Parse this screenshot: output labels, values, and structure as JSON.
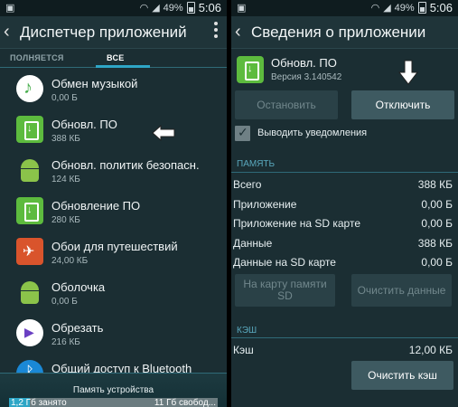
{
  "status_bar": {
    "battery_percent": "49%",
    "time": "5:06"
  },
  "left": {
    "title": "Диспетчер приложений",
    "tabs": [
      "ПОЛНЯЕТСЯ",
      "ВСЕ"
    ],
    "apps": [
      {
        "name": "Обмен музыкой",
        "size": "0,00 Б",
        "icon": "music-share-icon"
      },
      {
        "name": "Обновл. ПО",
        "size": "388 КБ",
        "icon": "software-update-icon"
      },
      {
        "name": "Обновл. политик безопасн.",
        "size": "124 КБ",
        "icon": "android-icon"
      },
      {
        "name": "Обновление ПО",
        "size": "280 КБ",
        "icon": "software-update-icon"
      },
      {
        "name": "Обои для путешествий",
        "size": "24,00 КБ",
        "icon": "travel-wallpaper-icon"
      },
      {
        "name": "Оболочка",
        "size": "0,00 Б",
        "icon": "android-icon"
      },
      {
        "name": "Обрезать",
        "size": "216 КБ",
        "icon": "trim-play-icon"
      },
      {
        "name": "Общий доступ к Bluetooth",
        "size": "",
        "icon": "bluetooth-icon"
      }
    ],
    "storage": {
      "title": "Память устройства",
      "used": "1,2 Гб занято",
      "free": "11 Гб свобод...",
      "used_fraction": 0.1
    }
  },
  "right": {
    "title": "Сведения о приложении",
    "app": {
      "name": "Обновл. ПО",
      "version": "Версия 3.140542"
    },
    "buttons": {
      "stop": "Остановить",
      "disable": "Отключить",
      "move_to_sd": "На карту памяти SD",
      "clear_data": "Очистить данные",
      "clear_cache": "Очистить кэш"
    },
    "notifications_label": "Выводить уведомления",
    "memory_header": "ПАМЯТЬ",
    "memory": [
      {
        "label": "Всего",
        "value": "388 КБ"
      },
      {
        "label": "Приложение",
        "value": "0,00 Б"
      },
      {
        "label": "Приложение на SD карте",
        "value": "0,00 Б"
      },
      {
        "label": "Данные",
        "value": "388 КБ"
      },
      {
        "label": "Данные на SD карте",
        "value": "0,00 Б"
      }
    ],
    "cache_header": "КЭШ",
    "cache": {
      "label": "Кэш",
      "value": "12,00 КБ"
    }
  }
}
